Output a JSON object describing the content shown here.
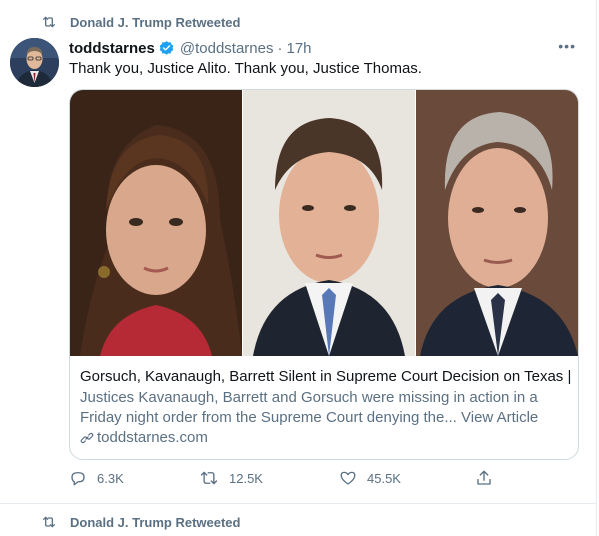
{
  "retweet_banner": {
    "text": "Donald J. Trump Retweeted",
    "icon": "retweet-icon"
  },
  "tweet": {
    "display_name": "toddstarnes",
    "verified": true,
    "handle": "@toddstarnes",
    "separator": "·",
    "time": "17h",
    "more_icon": "•••",
    "text": "Thank you, Justice Alito. Thank you, Justice Thomas.",
    "card": {
      "title": "Gorsuch, Kavanaugh, Barrett Silent in Supreme Court Decision on Texas |...",
      "description": "Justices Kavanaugh, Barrett and Gorsuch were missing in action in a Friday night order from the Supreme Court denying the... View Article",
      "domain": "toddstarnes.com"
    },
    "actions": {
      "reply_count": "6.3K",
      "retweet_count": "12.5K",
      "like_count": "45.5K"
    }
  },
  "next_retweet_banner": {
    "text": "Donald J. Trump Retweeted"
  },
  "colors": {
    "secondary_text": "#5b7083",
    "verified_blue": "#1da1f2",
    "border": "#e6ecf0"
  }
}
